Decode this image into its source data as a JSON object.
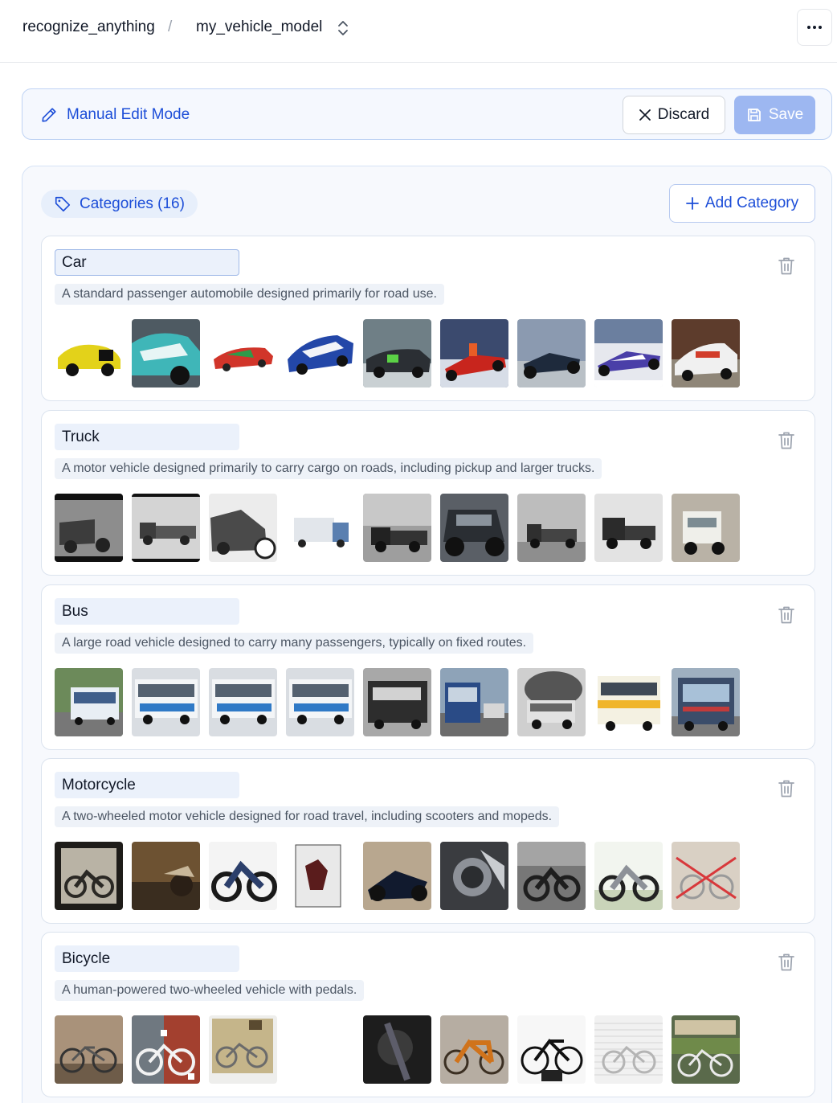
{
  "breadcrumb": {
    "project": "recognize_anything",
    "separator": "/",
    "model": "my_vehicle_model"
  },
  "banner": {
    "title": "Manual Edit Mode",
    "discard_label": "Discard",
    "save_label": "Save"
  },
  "categories_header": {
    "label": "Categories (16)",
    "add_label": "Add Category"
  },
  "categories": [
    {
      "name": "Car",
      "description": "A standard passenger automobile designed primarily for road use.",
      "thumbs": [
        "yellow stock car #95",
        "teal race car",
        "red and green race car",
        "blue and white stock car",
        "dark race car #41",
        "red open-wheel car",
        "open-wheel race car",
        "open-wheel car on track",
        "white rally car"
      ]
    },
    {
      "name": "Truck",
      "description": "A motor vehicle designed primarily to carry cargo on roads, including pickup and larger trucks.",
      "thumbs": [
        "vintage truck photo",
        "old flatbed truck",
        "antique truck",
        "white box truck",
        "vintage truck by building",
        "off-road pickup",
        "old dump truck",
        "vintage pickup",
        "white cab-over truck"
      ]
    },
    {
      "name": "Bus",
      "description": "A large road vehicle designed to carry many passengers, typically on fixed routes.",
      "thumbs": [
        "city bus on road",
        "blue and white bus",
        "blue and white bus",
        "blue and white bus",
        "burnt bus",
        "transit bus front",
        "burning bus",
        "yellow and white bus",
        "city bus at stop"
      ]
    },
    {
      "name": "Motorcycle",
      "description": "A two-wheeled motor vehicle designed for road travel, including scooters and mopeds.",
      "thumbs": [
        "vintage motorcycle photo",
        "motorcycle at dusk",
        "cruiser motorcycle",
        "motorcycle poster",
        "black sport motorcycle",
        "chrome motorcycle detail",
        "vintage motorcycle",
        "silver cruiser",
        "crossed-out bike drawing"
      ]
    },
    {
      "name": "Bicycle",
      "description": "A human-powered two-wheeled vehicle with pedals.",
      "thumbs": [
        "bicycle by stone wall",
        "white bicycle",
        "bicycle with basket",
        "",
        "dark bicycle detail",
        "orange bicycle",
        "black city bicycle",
        "bicycle by siding",
        "bicycle by work sign"
      ]
    }
  ],
  "colors": {
    "accent": "#1d4ed8",
    "save_disabled": "#9db7f1",
    "banner_bg": "#f5f8fe"
  }
}
